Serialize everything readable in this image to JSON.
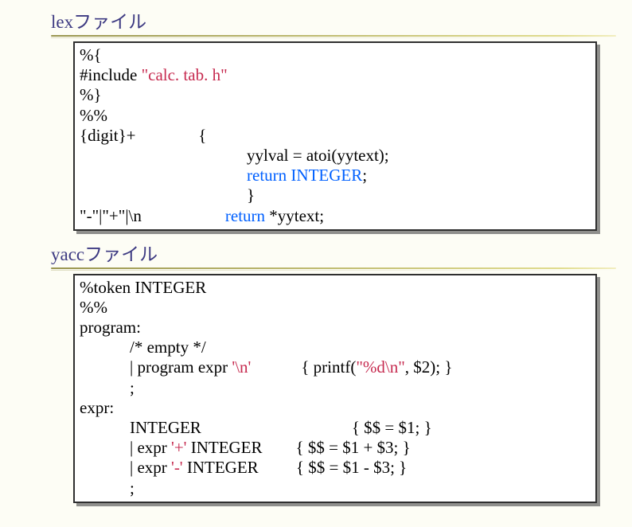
{
  "lex": {
    "title": "lexファイル",
    "code": {
      "l1a": "%{",
      "l2a": "#include ",
      "l2s": "\"calc. tab. h\"",
      "l3a": "%}",
      "l4a": "%%",
      "l5a": "{digit}+               {",
      "l6a": "                                        yylval = atoi(yytext);",
      "l7a": "                                        ",
      "l7k": "return",
      "l7b": " ",
      "l7c": "INTEGER",
      "l7d": ";",
      "l8a": "                                        }",
      "l9a": "\"-\"|\"+\"|\\n                    ",
      "l9k": "return",
      "l9b": " *yytext;"
    }
  },
  "yacc": {
    "title": "yaccファイル",
    "code": {
      "l1a": "%token INTEGER",
      "l2a": "%%",
      "l3a": "program:",
      "l4a": "            /* empty */",
      "l5a": "            | program expr ",
      "l5s": "'\\n'",
      "l5b": "            { printf(",
      "l5s2": "\"%d\\n\"",
      "l5c": ", $2); }",
      "l6a": "            ;",
      "l7a": "expr:",
      "l8a": "            INTEGER                                    { $$ = $1; }",
      "l9a": "            | expr ",
      "l9s": "'+'",
      "l9b": " INTEGER        { $$ = $1 + $3; }",
      "l10a": "            | expr ",
      "l10s": "'-'",
      "l10b": " INTEGER         { $$ = $1 - $3; }",
      "l11a": "            ;"
    }
  }
}
